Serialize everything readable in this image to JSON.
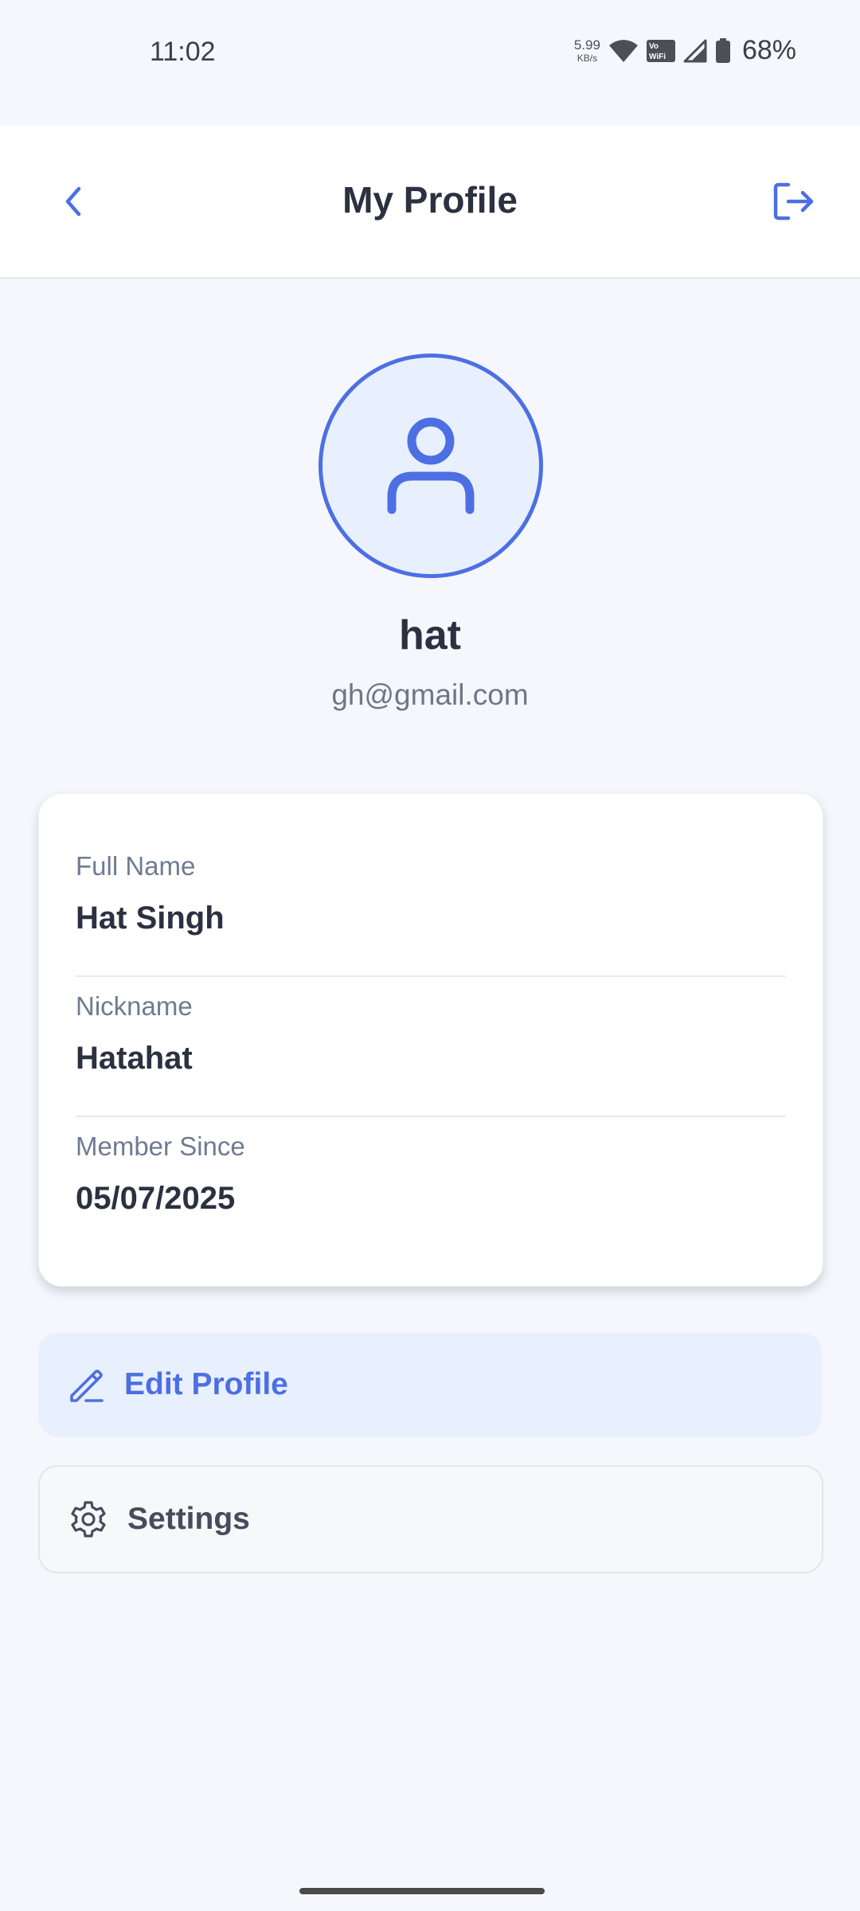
{
  "status_bar": {
    "time": "11:02",
    "net_speed_value": "5.99",
    "net_speed_unit": "KB/s",
    "vowifi_label": "Vo\nWiFi",
    "battery_percent": "68%"
  },
  "app_bar": {
    "title": "My Profile",
    "back_icon": "chevron-left-icon",
    "logout_icon": "logout-icon"
  },
  "profile": {
    "avatar_icon": "user-icon",
    "name": "hat",
    "email": "gh@gmail.com"
  },
  "info_card": {
    "rows": [
      {
        "label": "Full Name",
        "value": "Hat Singh"
      },
      {
        "label": "Nickname",
        "value": "Hatahat"
      },
      {
        "label": "Member Since",
        "value": "05/07/2025"
      }
    ]
  },
  "actions": {
    "edit_label": "Edit Profile",
    "edit_icon": "pencil-icon",
    "settings_label": "Settings",
    "settings_icon": "gear-icon"
  },
  "colors": {
    "accent": "#4d6fe4",
    "accent_light": "#e8f0fd",
    "background": "#f5f7fc",
    "text_primary": "#2b3140",
    "text_secondary": "#6e7c92"
  }
}
